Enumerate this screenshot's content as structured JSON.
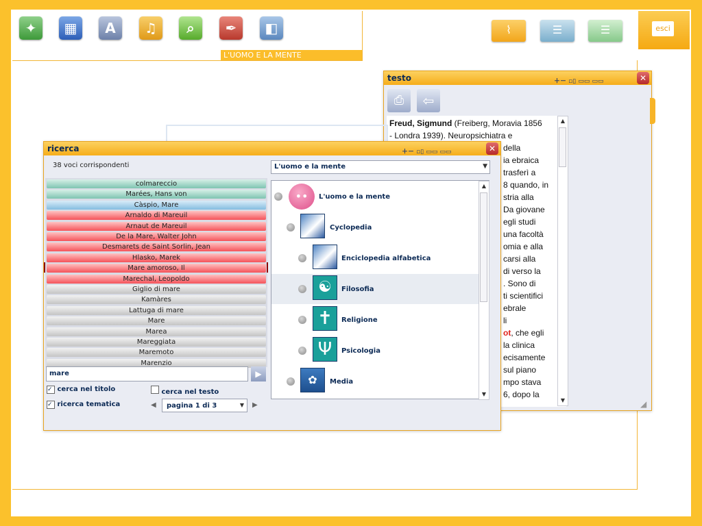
{
  "toolbar": {
    "section_title": "L'UOMO E LA MENTE",
    "icons": [
      "butterfly-icon",
      "clapperboard-icon",
      "letter-a-icon",
      "music-note-icon",
      "magnifier-icon",
      "quill-icon",
      "speaker-icon"
    ],
    "exit_label": "esci"
  },
  "colors": {
    "frame": "#fbc12c",
    "accent": "#f6ad1a",
    "title_text": "#0c2a55"
  },
  "testo_window": {
    "title": "testo",
    "text_head": "Freud, Sigmund",
    "text_lines": [
      " (Freiberg, Moravia 1856",
      "- Londra 1939). Neuropsichiatra e",
      "della",
      "ia ebraica",
      "trasferì a",
      "8 quando, in",
      "stria alla",
      "Da giovane",
      "egli studi",
      "una facoltà",
      "omia e alla",
      "carsi alla",
      "di verso la",
      ". Sono di",
      "ti scientifici",
      "ebrale",
      "li",
      ", che egli",
      "la clinica",
      "ecisamente",
      "sul piano",
      "mpo stava",
      "6, dopo la"
    ],
    "highlight": "ot"
  },
  "ricerca_window": {
    "title": "ricerca",
    "count_label": "38 voci corrispondenti",
    "dropdown_value": "L'uomo e la mente",
    "results": [
      {
        "label": "colmareccio",
        "color": "teal"
      },
      {
        "label": "Marées, Hans von",
        "color": "teal"
      },
      {
        "label": "Càspio, Mare",
        "color": "blue"
      },
      {
        "label": "Arnaldo di Mareuil",
        "color": "red"
      },
      {
        "label": "Arnaut de Mareuil",
        "color": "red"
      },
      {
        "label": "De la Mare, Walter John",
        "color": "red"
      },
      {
        "label": "Desmarets de Saint Sorlin, Jean",
        "color": "red"
      },
      {
        "label": "Hlasko, Marek",
        "color": "red"
      },
      {
        "label": "Mare amoroso, Il",
        "color": "red"
      },
      {
        "label": "Marechal, Leopoldo",
        "color": "red"
      },
      {
        "label": "Giglio di mare",
        "color": "gray"
      },
      {
        "label": "Kamàres",
        "color": "gray"
      },
      {
        "label": "Lattuga di mare",
        "color": "gray"
      },
      {
        "label": "Mare",
        "color": "gray"
      },
      {
        "label": "Marea",
        "color": "gray"
      },
      {
        "label": "Mareggiata",
        "color": "gray"
      },
      {
        "label": "Maremoto",
        "color": "gray"
      },
      {
        "label": "Marenzio",
        "color": "gray"
      }
    ],
    "search_value": "mare",
    "cb_title": "cerca nel titolo",
    "cb_text": "cerca nel testo",
    "cb_thematic": "ricerca tematica",
    "page_label": "pagina 1 di 3",
    "tree": [
      {
        "label": "L'uomo e la mente"
      },
      {
        "label": "Cyclopedia"
      },
      {
        "label": "Enciclopedia alfabetica"
      },
      {
        "label": "Filosofia"
      },
      {
        "label": "Religione"
      },
      {
        "label": "Psicologia"
      },
      {
        "label": "Media"
      }
    ]
  }
}
